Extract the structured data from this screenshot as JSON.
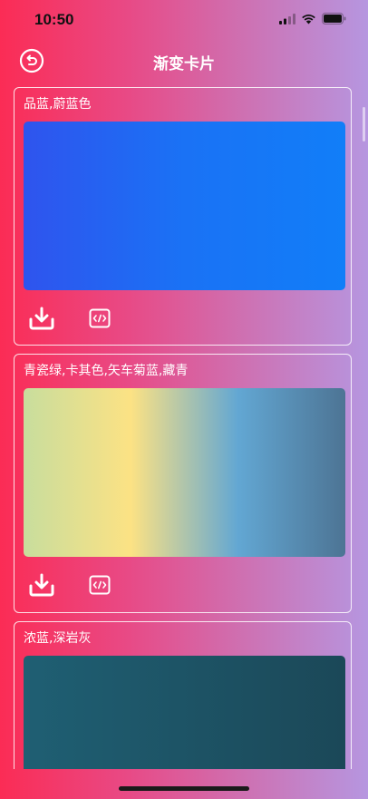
{
  "status": {
    "time": "10:50"
  },
  "nav": {
    "title": "渐变卡片",
    "back_icon": "refresh-back-icon"
  },
  "cards": [
    {
      "title": "品蓝,蔚蓝色",
      "gradient": [
        "#2f54ee",
        "#1a72f5",
        "#117ef8"
      ],
      "download_icon": "download-icon",
      "code_icon": "code-icon"
    },
    {
      "title": "青瓷绿,卡其色,矢车菊蓝,藏青",
      "gradient": [
        "#c8dd9d",
        "#fce284",
        "#62a7d3",
        "#4d7494"
      ],
      "download_icon": "download-icon",
      "code_icon": "code-icon"
    },
    {
      "title": "浓蓝,深岩灰",
      "gradient": [
        "#1f5f73",
        "#1b4858"
      ],
      "download_icon": "download-icon",
      "code_icon": "code-icon"
    }
  ],
  "colors": {
    "text": "#ffffff",
    "status_text": "#111111"
  }
}
